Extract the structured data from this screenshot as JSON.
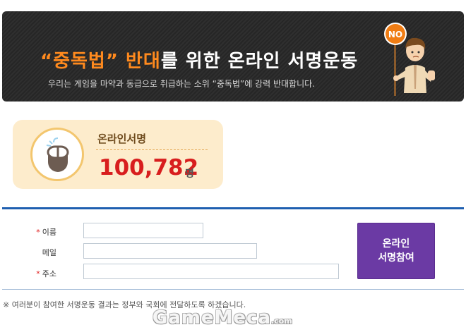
{
  "banner": {
    "title_hl1": "“중독법” 반대",
    "title_rest": "를 위한 온라인 서명운동",
    "subtitle": "우리는 게임을 마약과 동급으로 취급하는 소위 “중독법”에 강력 반대합니다.",
    "sign_text": "NO",
    "accent_color": "#ff8a1e"
  },
  "counter": {
    "icon": "mouse-icon",
    "label": "온라인서명",
    "value": "100,782",
    "unit": "명"
  },
  "form": {
    "fields": [
      {
        "label": "이름",
        "required": true,
        "value": ""
      },
      {
        "label": "메일",
        "required": false,
        "value": ""
      },
      {
        "label": "주소",
        "required": true,
        "value": ""
      }
    ],
    "required_mark": "*",
    "submit_line1": "온라인",
    "submit_line2": "서명참여",
    "submit_color": "#6b3aa4"
  },
  "notice": "※ 여러분이 참여한 서명운동 결과는 정부와 국회에 전달하도록 하겠습니다.",
  "watermark": {
    "brand": "GameMeca",
    "domain": ".com"
  }
}
